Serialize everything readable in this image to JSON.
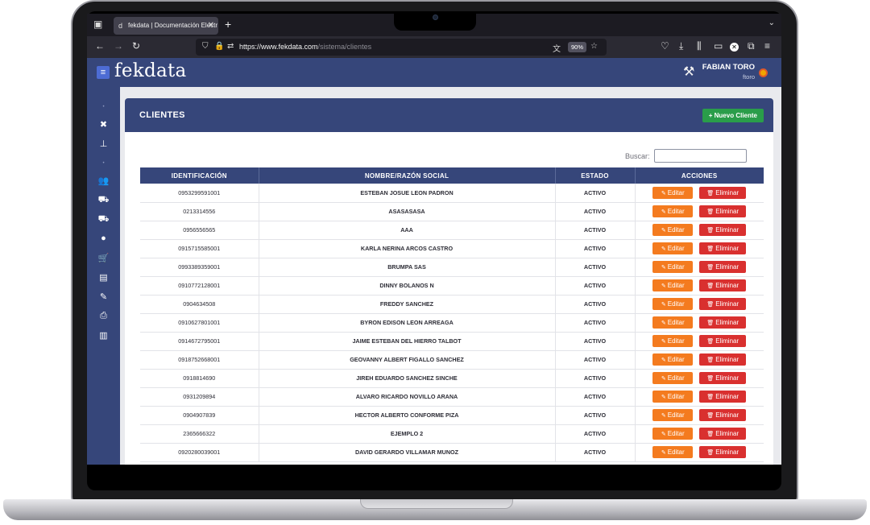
{
  "browser": {
    "tab_title": "fekdata | Documentación Electr",
    "tab_favicon": "d",
    "url_host": "https://www.fekdata.com",
    "url_path": "/sistema/clientes",
    "zoom": "90%"
  },
  "app": {
    "logo": "fekdata",
    "user_name": "FABIAN TORO",
    "user_handle": "ftoro"
  },
  "page": {
    "title": "CLIENTES",
    "new_button": "+ Nuevo Cliente",
    "search_label": "Buscar:"
  },
  "table": {
    "headers": [
      "IDENTIFICACIÓN",
      "NOMBRE/RAZÓN SOCIAL",
      "ESTADO",
      "ACCIONES"
    ],
    "edit_label": "Editar",
    "delete_label": "Eliminar",
    "rows": [
      {
        "id": "0953299591001",
        "name": "ESTEBAN JOSUE LEON PADRON",
        "state": "ACTIVO"
      },
      {
        "id": "0213314556",
        "name": "ASASASASA",
        "state": "ACTIVO"
      },
      {
        "id": "0956556565",
        "name": "AAA",
        "state": "ACTIVO"
      },
      {
        "id": "0915715585001",
        "name": "KARLA NERINA ARCOS CASTRO",
        "state": "ACTIVO"
      },
      {
        "id": "0993389359001",
        "name": "BRUMPA SAS",
        "state": "ACTIVO"
      },
      {
        "id": "0910772128001",
        "name": "DINNY BOLANOS N",
        "state": "ACTIVO"
      },
      {
        "id": "0904634508",
        "name": "FREDDY SANCHEZ",
        "state": "ACTIVO"
      },
      {
        "id": "0910627801001",
        "name": "BYRON EDISON LEON ARREAGA",
        "state": "ACTIVO"
      },
      {
        "id": "0914672795001",
        "name": "JAIME ESTEBAN DEL HIERRO TALBOT",
        "state": "ACTIVO"
      },
      {
        "id": "0918752668001",
        "name": "GEOVANNY ALBERT FIGALLO SANCHEZ",
        "state": "ACTIVO"
      },
      {
        "id": "0918814690",
        "name": "JIREH EDUARDO SANCHEZ SINCHE",
        "state": "ACTIVO"
      },
      {
        "id": "0931209894",
        "name": "ALVARO RICARDO NOVILLO ARANA",
        "state": "ACTIVO"
      },
      {
        "id": "0904907839",
        "name": "HECTOR ALBERTO CONFORME PIZA",
        "state": "ACTIVO"
      },
      {
        "id": "2365666322",
        "name": "EJEMPLO 2",
        "state": "ACTIVO"
      },
      {
        "id": "0920280039001",
        "name": "DAVID GERARDO VILLAMAR MUNOZ",
        "state": "ACTIVO"
      }
    ]
  },
  "colors": {
    "primary": "#36467a",
    "edit": "#f47b1f",
    "delete": "#d9302f",
    "success": "#2a9d4a"
  }
}
